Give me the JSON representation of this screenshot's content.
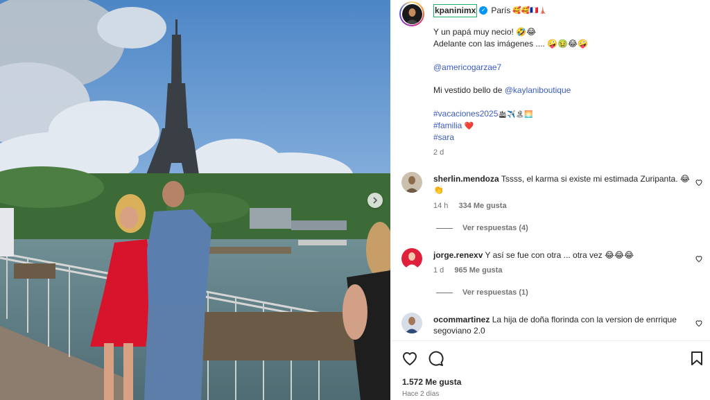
{
  "post": {
    "author": "kpaninimx",
    "location_text": "París",
    "location_emoji": "🥰🥰🇫🇷🗼",
    "caption_lines": [
      "Y un papá muy necio! 🤣😂",
      "Adelante con las imágenes .... 🤪🤢😂🤪"
    ],
    "mention_1": "@americogarzae7",
    "dress_prefix": "Mi vestido bello de ",
    "mention_2": "@kaylaniboutique",
    "hashtag_1": "#vacaciones2025",
    "hashtag_1_emoji": "🛳✈️🏝🌅",
    "hashtag_2": "#familia",
    "hashtag_2_emoji": "❤️",
    "hashtag_3": "#sara",
    "time": "2 d"
  },
  "comments": [
    {
      "user": "sherlin.mendoza",
      "text": "Tssss, el karma si existe mi estimada Zuripanta. 😂👏",
      "time": "14 h",
      "likes": "334 Me gusta",
      "replies": "Ver respuestas (4)"
    },
    {
      "user": "jorge.renexv",
      "text": "Y así se fue con otra ... otra vez 😂😂😂",
      "time": "1 d",
      "likes": "965 Me gusta",
      "replies": "Ver respuestas (1)"
    },
    {
      "user": "ocommartinez",
      "text": "La hija de doña florinda con la version de enrrique segoviano 2.0"
    }
  ],
  "footer": {
    "likes": "1.572 Me gusta",
    "ago": "Hace 2 días"
  },
  "colors": {
    "link": "#3b5bc0",
    "verified": "#0095f6",
    "muted": "#737373"
  },
  "icons": [
    "chevron-right-icon",
    "verified-icon",
    "heart-icon",
    "comment-icon",
    "bookmark-icon"
  ]
}
